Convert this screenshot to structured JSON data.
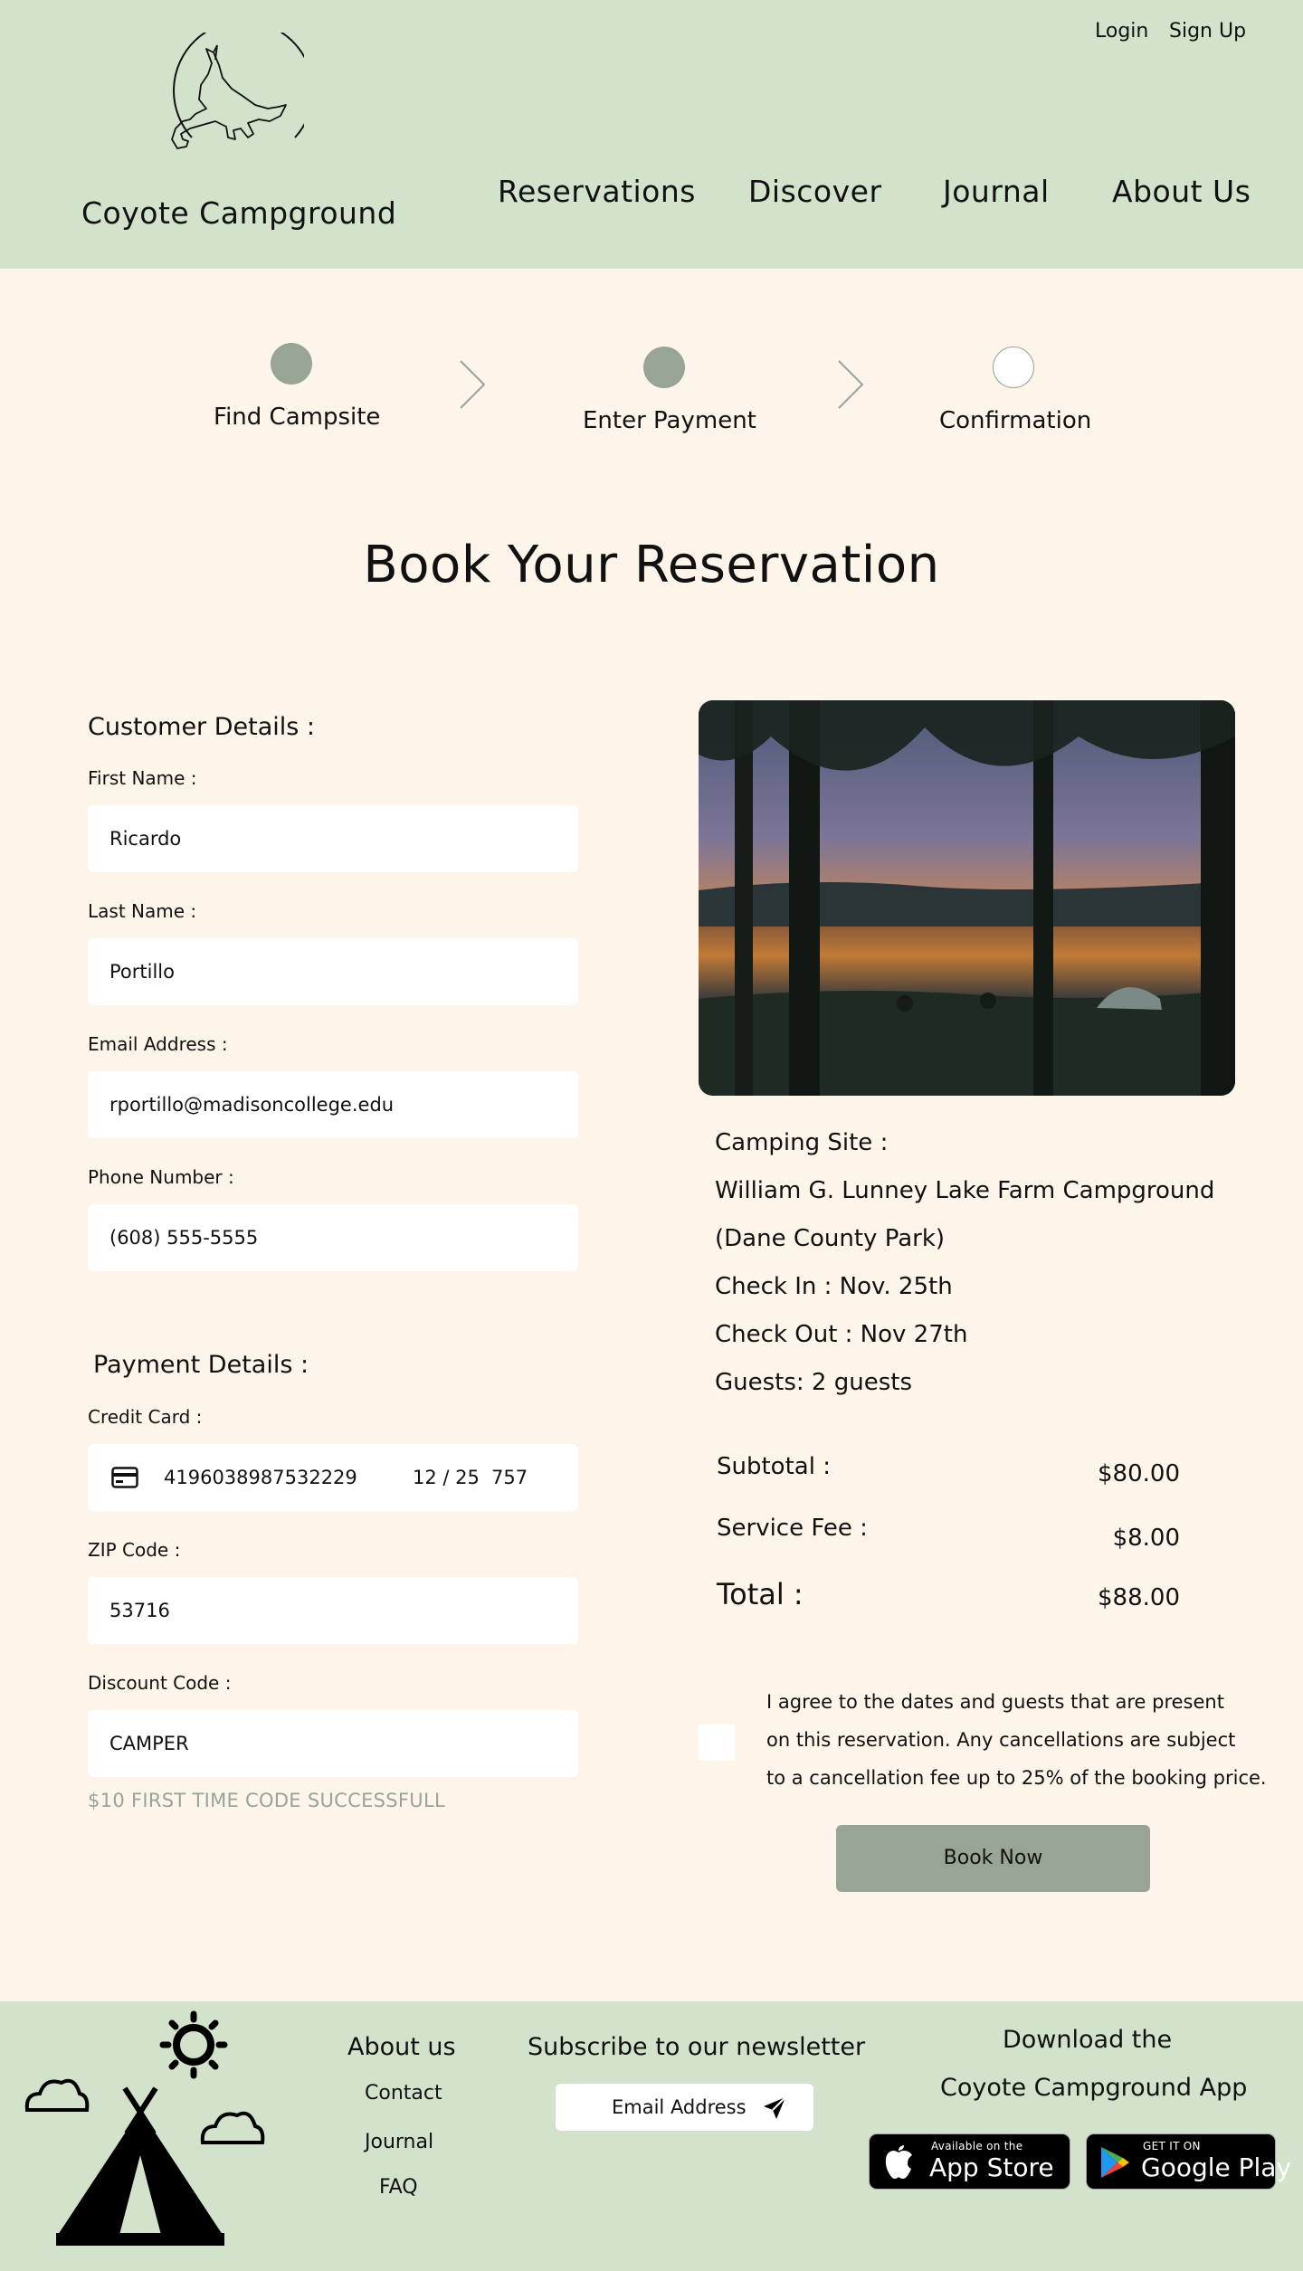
{
  "header": {
    "brand": "Coyote Campground",
    "login": "Login",
    "signup": "Sign Up",
    "nav": [
      "Reservations",
      "Discover",
      "Journal",
      "About Us"
    ]
  },
  "steps": [
    "Find Campsite",
    "Enter Payment",
    "Confirmation"
  ],
  "page_title": "Book Your Reservation",
  "customer": {
    "title": "Customer Details :",
    "first_name_label": "First Name :",
    "first_name": "Ricardo",
    "last_name_label": "Last Name :",
    "last_name": "Portillo",
    "email_label": "Email Address :",
    "email": "rportillo@madisoncollege.edu",
    "phone_label": "Phone Number :",
    "phone": "(608) 555-5555"
  },
  "payment": {
    "title": "Payment Details :",
    "card_label": "Credit Card :",
    "card_number": "4196038987532229",
    "card_expiry": "12 / 25",
    "card_cvc": "757",
    "zip_label": "ZIP Code :",
    "zip": "53716",
    "discount_label": "Discount Code :",
    "discount": "CAMPER",
    "discount_message": "$10 FIRST TIME CODE SUCCESSFULL"
  },
  "summary": {
    "lines": [
      "Camping Site :",
      "William G. Lunney Lake Farm  Campground",
      "(Dane County Park)",
      "Check In : Nov. 25th",
      "Check Out : Nov 27th",
      "Guests: 2 guests"
    ],
    "subtotal_label": "Subtotal :",
    "subtotal": "$80.00",
    "fee_label": "Service Fee :",
    "fee": "$8.00",
    "total_label": "Total :",
    "total": "$88.00"
  },
  "agreement": [
    "I agree to the dates and guests that are present",
    "on this reservation. Any cancellations are subject",
    "to a cancellation fee up to 25% of the booking price."
  ],
  "book_now": "Book Now",
  "footer": {
    "about_title": "About us",
    "links": [
      "Contact",
      "Journal",
      "FAQ"
    ],
    "newsletter_title": "Subscribe to our newsletter",
    "email_placeholder": "Email Address",
    "app_title_1": "Download the",
    "app_title_2": "Coyote Campground App",
    "appstore_small": "Available on the",
    "appstore_big": "App Store",
    "googleplay_small": "GET IT ON",
    "googleplay_big": "Google Play"
  },
  "colors": {
    "header_bg": "#d3e3cb",
    "page_bg": "#fdf4ea",
    "accent": "#98a595"
  }
}
